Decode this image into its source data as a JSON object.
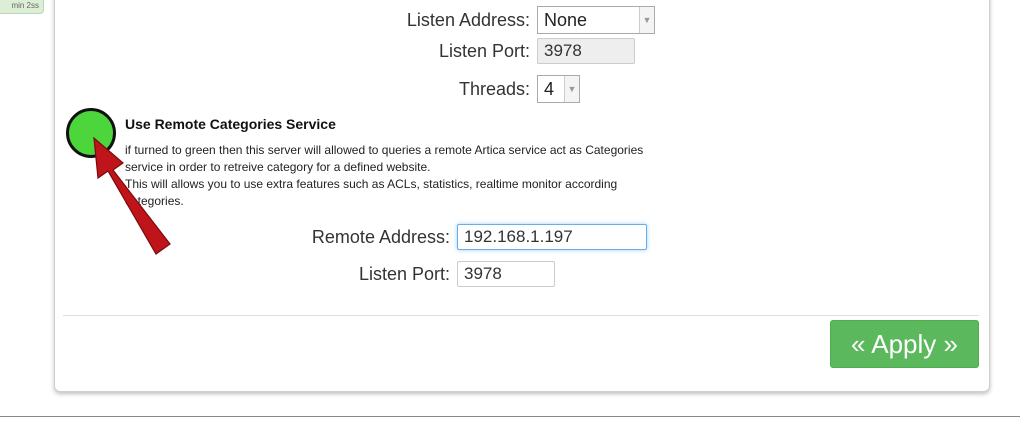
{
  "corner_badge": "min 2ss",
  "listen_address": {
    "label": "Listen Address:",
    "value": "None"
  },
  "listen_port_top": {
    "label": "Listen Port:",
    "value": "3978"
  },
  "threads": {
    "label": "Threads:",
    "value": "4"
  },
  "remote_service": {
    "title": "Use Remote Categories Service",
    "description_line1": "if turned to green then this server will allowed to queries a remote Artica service act as Categories",
    "description_line2": "service in order to retreive category for a defined website.",
    "description_line3": "This will allows you to use extra features such as ACLs, statistics, realtime monitor according",
    "description_line4": "categories.",
    "toggle_state": "on",
    "toggle_color": "#4cd63c"
  },
  "remote_address": {
    "label": "Remote Address:",
    "value": "192.168.1.197"
  },
  "listen_port_bottom": {
    "label": "Listen Port:",
    "value": "3978"
  },
  "apply_button": {
    "label": "« Apply »",
    "color": "#5cb85c"
  },
  "annotation_arrow_color": "#c0141b"
}
